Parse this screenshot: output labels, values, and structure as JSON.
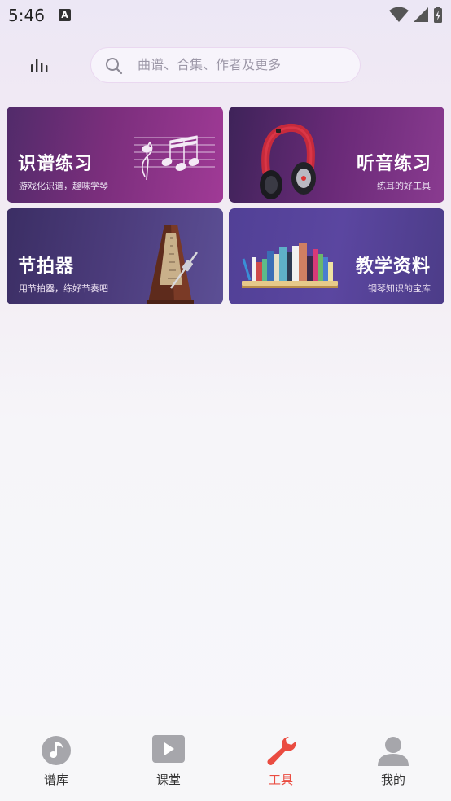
{
  "status_bar": {
    "time": "5:46",
    "notification_letter": "A",
    "icons": [
      "wifi-icon",
      "cell-signal-icon",
      "battery-charging-icon"
    ]
  },
  "header": {
    "left_icon": "equalizer-icon",
    "search": {
      "placeholder": "曲谱、合集、作者及更多",
      "value": "",
      "icon": "search-icon"
    }
  },
  "tools": [
    {
      "title": "识谱练习",
      "subtitle": "游戏化识谱，趣味学琴",
      "image": "sheet-music-notes"
    },
    {
      "title": "听音练习",
      "subtitle": "练耳的好工具",
      "image": "headphones"
    },
    {
      "title": "节拍器",
      "subtitle": "用节拍器，练好节奏吧",
      "image": "metronome"
    },
    {
      "title": "教学资料",
      "subtitle": "钢琴知识的宝库",
      "image": "bookshelf"
    }
  ],
  "bottom_nav": {
    "active_index": 2,
    "active_color": "#ea4c41",
    "inactive_color": "#a6a6ab",
    "items": [
      {
        "label": "谱库",
        "icon": "music-note-icon"
      },
      {
        "label": "课堂",
        "icon": "play-video-icon"
      },
      {
        "label": "工具",
        "icon": "wrench-icon"
      },
      {
        "label": "我的",
        "icon": "user-icon"
      }
    ]
  },
  "colors": {
    "card_1": "#8a3490",
    "card_2": "#6a2a78",
    "card_3": "#4c3c7c",
    "card_4": "#5b46a0"
  }
}
